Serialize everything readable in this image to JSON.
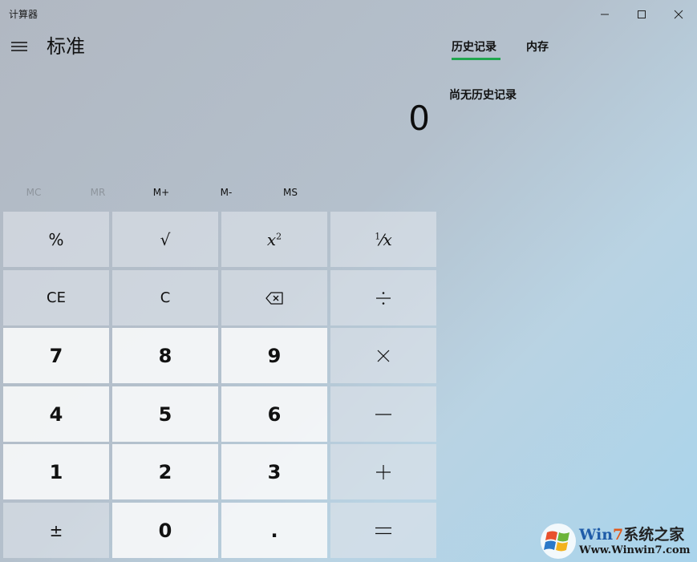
{
  "window": {
    "title": "计算器"
  },
  "header": {
    "mode": "标准"
  },
  "display": {
    "value": "0"
  },
  "memory": {
    "mc": "MC",
    "mr": "MR",
    "mplus": "M+",
    "mminus": "M-",
    "ms": "MS"
  },
  "keys": {
    "percent": "%",
    "sqrt": "√",
    "square_base": "x",
    "square_exp": "2",
    "recip_num": "1",
    "recip_x": "x",
    "ce": "CE",
    "clear": "C",
    "n7": "7",
    "n8": "8",
    "n9": "9",
    "n4": "4",
    "n5": "5",
    "n6": "6",
    "n1": "1",
    "n2": "2",
    "n3": "3",
    "negate": "±",
    "n0": "0",
    "decimal": "."
  },
  "panel": {
    "tab_history": "历史记录",
    "tab_memory": "内存",
    "empty_history": "尚无历史记录",
    "accent_color": "#1fa64d"
  },
  "watermark": {
    "brand_prefix": "Win",
    "brand_number": "7",
    "brand_suffix": "系统之家",
    "url": "Www.Winwin7.com"
  },
  "icons": {
    "menu": "hamburger-menu-icon",
    "minimize": "minimize-icon",
    "maximize": "maximize-icon",
    "close": "close-icon",
    "backspace": "backspace-icon",
    "divide": "divide-icon",
    "multiply": "multiply-icon",
    "subtract": "subtract-icon",
    "add": "add-icon",
    "equals": "equals-icon",
    "logo": "windows-logo-icon"
  }
}
